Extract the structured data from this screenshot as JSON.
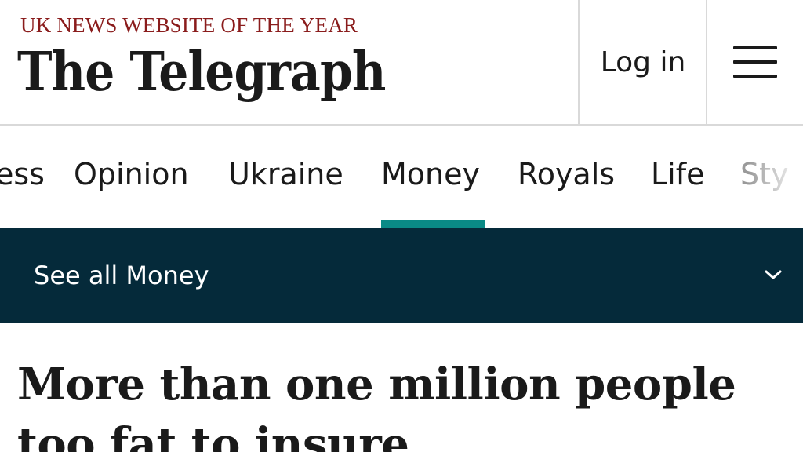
{
  "header": {
    "tagline": "UK NEWS WEBSITE OF THE YEAR",
    "masthead": "The Telegraph",
    "login_label": "Log in",
    "menu_icon": "hamburger-menu-icon"
  },
  "nav": {
    "items": [
      {
        "label": "ess"
      },
      {
        "label": "Opinion"
      },
      {
        "label": "Ukraine"
      },
      {
        "label": "Money"
      },
      {
        "label": "Royals"
      },
      {
        "label": "Life"
      },
      {
        "label": "Sty"
      }
    ],
    "active": "Money",
    "active_color": "#0a8a86"
  },
  "section_bar": {
    "label": "See all Money",
    "icon": "chevron-down-icon",
    "background": "#052a3a"
  },
  "article": {
    "headline": "More than one million people too fat to insure"
  },
  "colors": {
    "tagline": "#8a1c1c",
    "text": "#1a1a1a"
  }
}
